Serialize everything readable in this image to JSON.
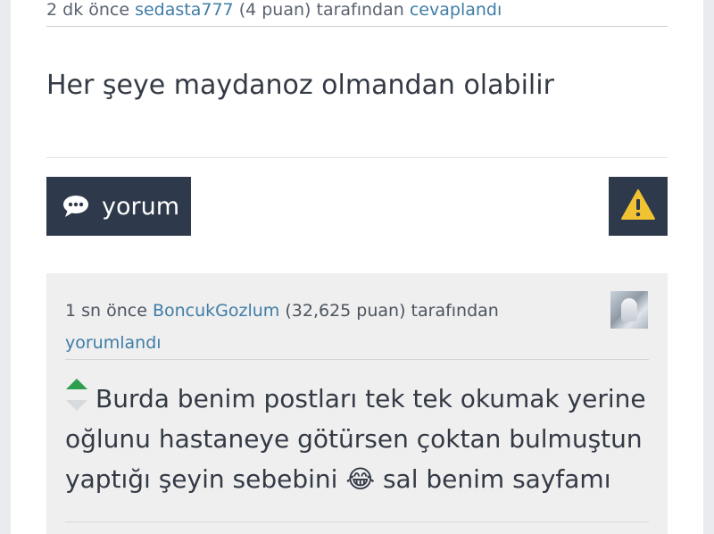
{
  "answer": {
    "time": "2 dk önce",
    "author": "sedasta777",
    "points": "(4 puan)",
    "by": "tarafından",
    "action": "cevaplandı",
    "text": "Her şeye maydanoz olmandan olabilir"
  },
  "actions": {
    "comment_label": "yorum",
    "comment_icon": "speech-bubble-icon",
    "flag_icon": "warning-icon",
    "flag_color": "#f1c232"
  },
  "comment": {
    "time": "1 sn önce",
    "author": "BoncukGozlum",
    "points": "(32,625 puan)",
    "by": "tarafından",
    "action": "yorumlandı",
    "text_part1": "Burda benim postları tek tek okumak yerine oğlunu hastaneye götürsen çoktan bulmuştun yaptığı şeyin sebebini",
    "text_part2": "sal benim sayfamı",
    "emoji": "😂"
  },
  "colors": {
    "link": "#3f7da7",
    "button_bg": "#2e3a4b",
    "upvote": "#2e9e4f"
  }
}
